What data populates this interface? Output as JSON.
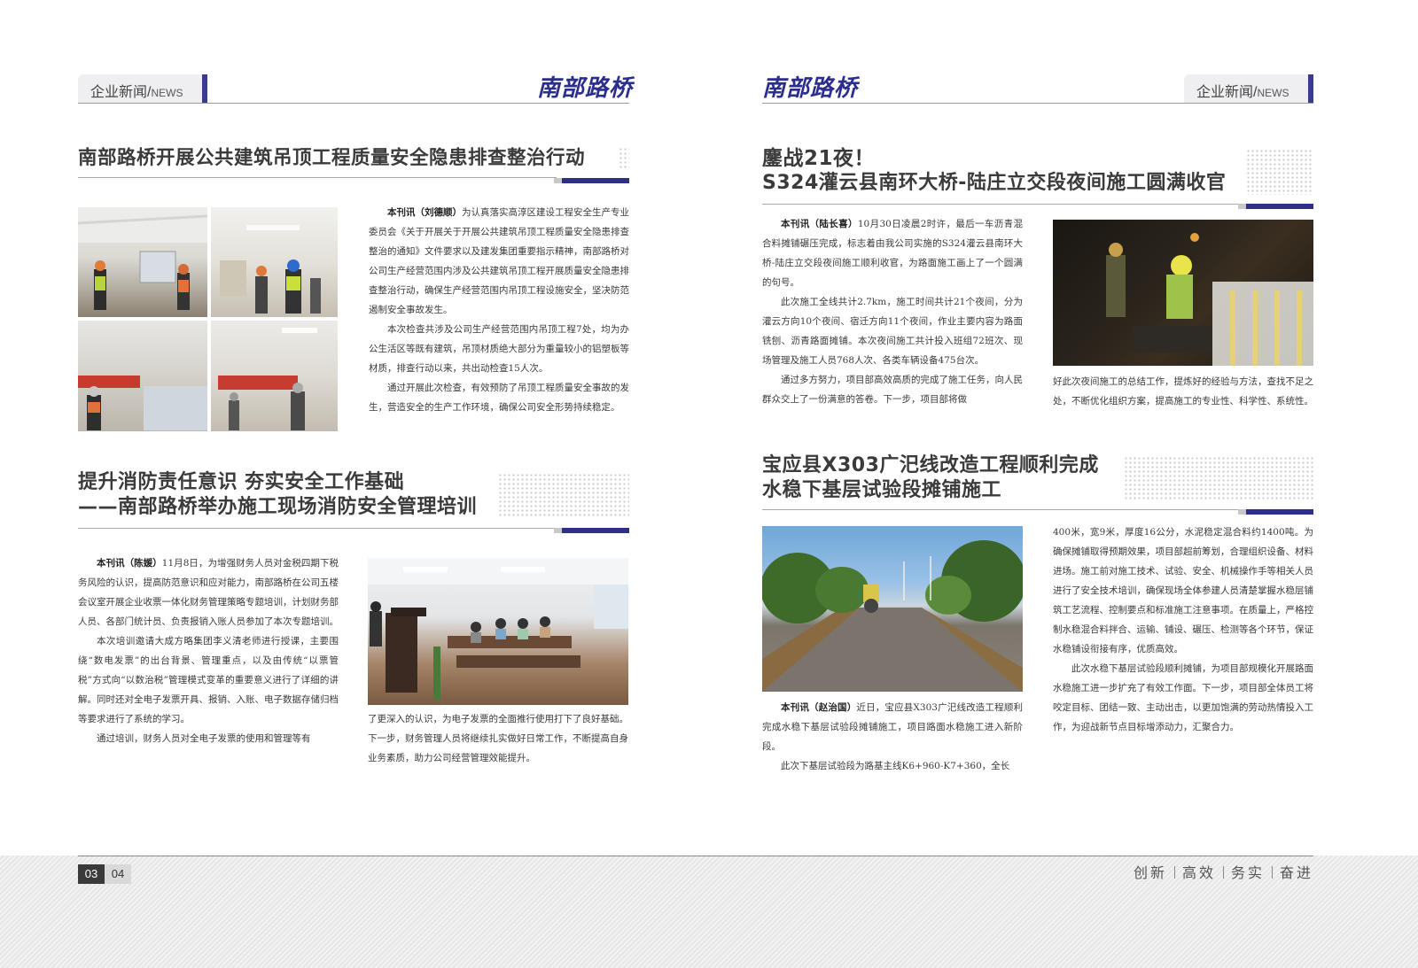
{
  "header": {
    "left_tab_cn": "企业新闻",
    "left_tab_sep": "/",
    "left_tab_en": "NEWS",
    "right_tab_cn": "企业新闻",
    "right_tab_sep": "/",
    "right_tab_en": "NEWS",
    "brand_left": "南部路桥",
    "brand_right": "南部路桥"
  },
  "article1": {
    "title": "南部路桥开展公共建筑吊顶工程质量安全隐患排查整治行动",
    "byline": "本刊讯（刘德顺）",
    "p1": "为认真落实高淳区建设工程安全生产专业委员会《关于开展关于开展公共建筑吊顶工程质量安全隐患排查整治的通知》文件要求以及建发集团重要指示精神，南部路桥对公司生产经营范围内涉及公共建筑吊顶工程开展质量安全隐患排查整治行动，确保生产经营范围内吊顶工程设施安全，坚决防范遏制安全事故发生。",
    "p2": "本次检查共涉及公司生产经营范围内吊顶工程7处，均为办公生活区等既有建筑，吊顶材质绝大部分为重量较小的铝塑板等材质，排查行动以来，共出动检查15人次。",
    "p3": "通过开展此次检查，有效预防了吊顶工程质量安全事故的发生，营造安全的生产工作环境，确保公司安全形势持续稳定。"
  },
  "article2": {
    "title_line1": "提升消防责任意识 夯实安全工作基础",
    "title_line2": "——南部路桥举办施工现场消防安全管理培训",
    "byline": "本刊讯（陈媛）",
    "p1": "11月8日，为增强财务人员对金税四期下税务风险的认识，提高防范意识和应对能力，南部路桥在公司五楼会议室开展企业收票一体化财务管理策略专题培训，计划财务部人员、各部门统计员、负责报销入账人员参加了本次专题培训。",
    "p2": "本次培训邀请大成方略集团李义清老师进行授课，主要围绕“数电发票”的出台背景、管理重点，以及由传统“以票管税”方式向“以数治税”管理模式变革的重要意义进行了详细的讲解。同时还对全电子发票开具、报销、入账、电子数据存储归档等要求进行了系统的学习。",
    "p3": "通过培训，财务人员对全电子发票的使用和管理等有",
    "p3_cont": "了更深入的认识，为电子发票的全面推行使用打下了良好基础。下一步，财务管理人员将继续扎实做好日常工作，不断提高自身业务素质，助力公司经营管理效能提升。"
  },
  "article3": {
    "title_line1": "鏖战21夜！",
    "title_line2": "S324灌云县南环大桥-陆庄立交段夜间施工圆满收官",
    "byline": "本刊讯（陆长喜）",
    "p1": "10月30日凌晨2时许，最后一车沥青混合料摊铺碾压完成，标志着由我公司实施的S324灌云县南环大桥-陆庄立交段夜间施工顺利收官，为路面施工画上了一个圆满的句号。",
    "p2": "此次施工全线共计2.7km，施工时间共计21个夜间，分为灌云方向10个夜间、宿迁方向11个夜间，作业主要内容为路面铣刨、沥青路面摊铺。本次夜间施工共计投入班组72班次、现场管理及施工人员768人次、各类车辆设备475台次。",
    "p3": "通过多方努力，项目部高效高质的完成了施工任务，向人民群众交上了一份满意的答卷。下一步，项目部将做",
    "p3_cont": "好此次夜间施工的总结工作，提炼好的经验与方法，查找不足之处，不断优化组织方案，提高施工的专业性、科学性、系统性。"
  },
  "article4": {
    "title_line1": "宝应县X303广汜线改造工程顺利完成",
    "title_line2": "水稳下基层试验段摊铺施工",
    "byline": "本刊讯（赵治国）",
    "p1": "近日，宝应县X303广汜线改造工程顺利完成水稳下基层试验段摊铺施工，项目路面水稳施工进入新阶段。",
    "p2": "此次下基层试验段为路基主线K6+960-K7+360，全长",
    "p2_cont": "400米，宽9米，厚度16公分，水泥稳定混合料约1400吨。为确保摊铺取得预期效果，项目部超前筹划，合理组织设备、材料进场。施工前对施工技术、试验、安全、机械操作手等相关人员进行了安全技术培训，确保现场全体参建人员清楚掌握水稳层铺筑工艺流程、控制要点和标准施工注意事项。在质量上，严格控制水稳混合料拌合、运输、铺设、碾压、检测等各个环节，保证水稳铺设衔接有序，优质高效。",
    "p3": "此次水稳下基层试验段顺利摊铺，为项目部规模化开展路面水稳施工进一步扩充了有效工作面。下一步，项目部全体员工将咬定目标、团结一致、主动出击，以更加饱满的劳动热情投入工作，为迎战新节点目标增添动力，汇聚合力。"
  },
  "footer": {
    "page_left": "03",
    "page_right": "04",
    "slogan": [
      "创新",
      "高效",
      "务实",
      "奋进"
    ]
  },
  "colors": {
    "brand_blue": "#2f2f86",
    "text": "#3a3a3a",
    "title": "#3b3b3b"
  }
}
